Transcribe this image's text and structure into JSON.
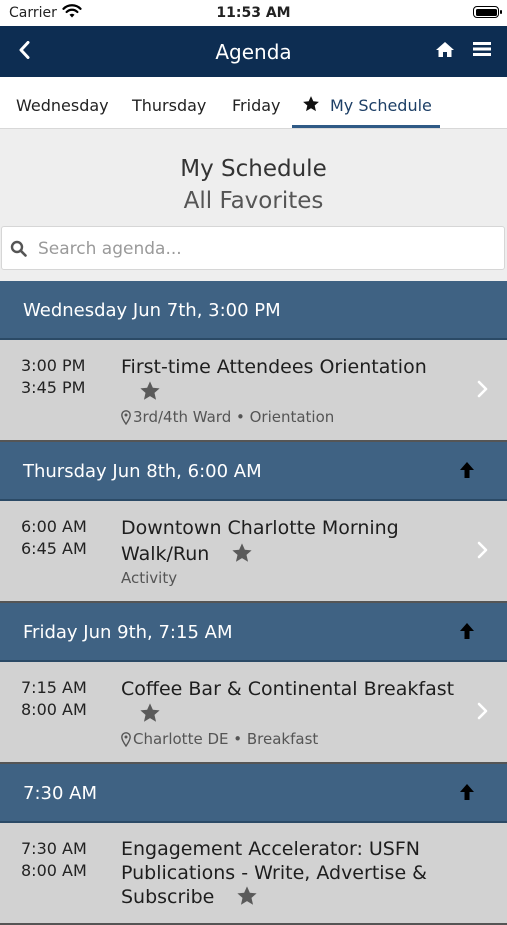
{
  "status_bar": {
    "carrier": "Carrier",
    "time": "11:53 AM"
  },
  "header": {
    "title": "Agenda",
    "icons": [
      "back-icon",
      "home-icon",
      "menu-icon"
    ]
  },
  "tabs": [
    {
      "label": "Wednesday",
      "active": false
    },
    {
      "label": "Thursday",
      "active": false
    },
    {
      "label": "Friday",
      "active": false
    },
    {
      "label": "My Schedule",
      "active": true,
      "icon": "star-icon"
    }
  ],
  "page": {
    "heading": "My Schedule",
    "subheading": "All Favorites"
  },
  "search": {
    "placeholder": "Search agenda...",
    "value": ""
  },
  "groups": [
    {
      "header": "Wednesday Jun 7th, 3:00 PM",
      "sessions": [
        {
          "start": "3:00 PM",
          "end": "3:45 PM",
          "title": "First-time Attendees Orientation",
          "location": "3rd/4th Ward • Orientation",
          "favorite": true
        }
      ]
    },
    {
      "header": "Thursday Jun 8th, 6:00 AM",
      "sessions": [
        {
          "start": "6:00 AM",
          "end": "6:45 AM",
          "title_line1": "Downtown Charlotte Morning",
          "title_line2": "Walk/Run",
          "category": "Activity",
          "favorite": true
        }
      ]
    },
    {
      "header": "Friday Jun 9th, 7:15 AM",
      "sessions": [
        {
          "start": "7:15 AM",
          "end": "8:00 AM",
          "title": "Coffee Bar & Continental Breakfast",
          "location": "Charlotte DE • Breakfast",
          "favorite": true
        }
      ]
    },
    {
      "header": "7:30 AM",
      "sessions": [
        {
          "start": "7:30 AM",
          "end": "8:00 AM",
          "title_line1": "Engagement Accelerator: USFN",
          "title_line2": "Publications - Write, Advertise &",
          "title_line3": "Subscribe",
          "favorite": true
        }
      ]
    }
  ],
  "colors": {
    "navbar": "#0d2d52",
    "group_header": "#3f6283",
    "session_bg": "#d2d2d2",
    "accent": "#2f5a86"
  }
}
